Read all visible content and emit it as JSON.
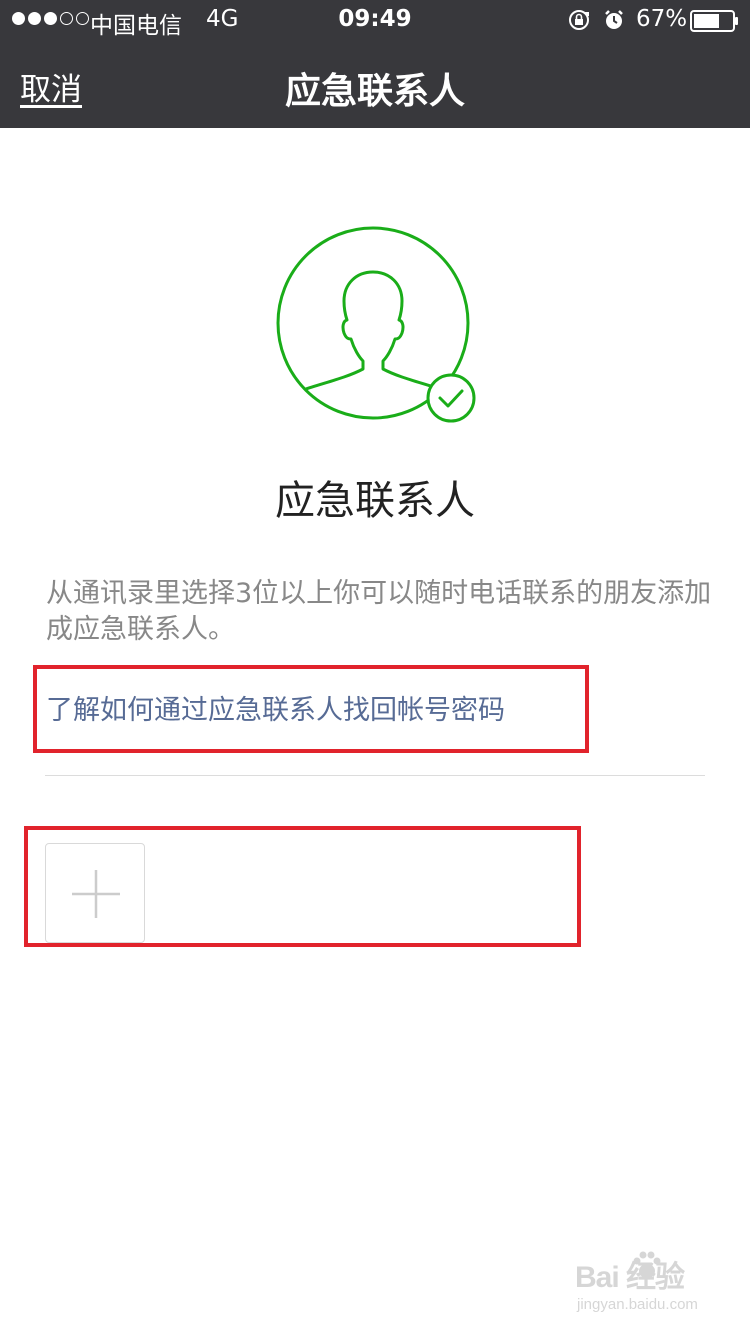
{
  "status_bar": {
    "carrier": "中国电信",
    "network": "4G",
    "time": "09:49",
    "battery_percent": "67%",
    "battery_level": 0.67
  },
  "nav": {
    "cancel_label": "取消",
    "title": "应急联系人"
  },
  "main": {
    "heading": "应急联系人",
    "description": "从通讯录里选择3位以上你可以随时电话联系的朋友添加成应急联系人。",
    "help_link": "了解如何通过应急联系人找回帐号密码"
  },
  "watermark": {
    "logo": "Bai 经验",
    "url": "jingyan.baidu.com"
  },
  "colors": {
    "nav_background": "#38383c",
    "accent_green": "#1aad19",
    "link_blue": "#576b95",
    "highlight_red": "#e1232c"
  },
  "icons": {
    "avatar": "person-silhouette-icon",
    "check": "check-badge-icon",
    "add": "plus-icon",
    "rotation_lock": "rotation-lock-icon",
    "alarm": "alarm-icon",
    "battery": "battery-icon"
  }
}
